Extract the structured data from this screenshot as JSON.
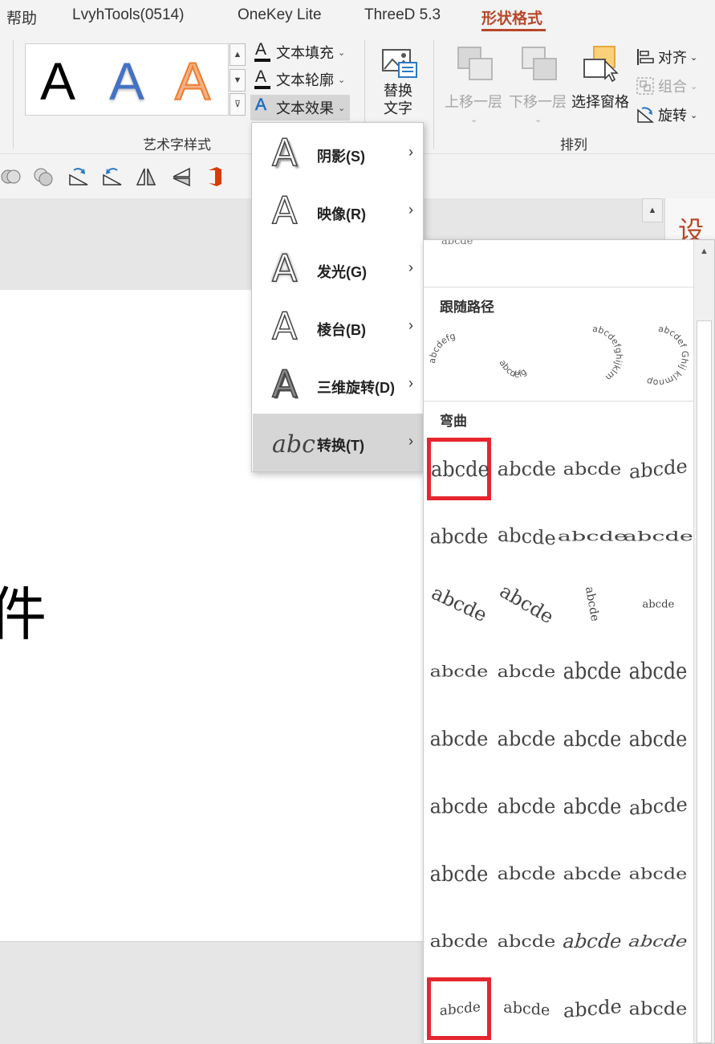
{
  "tabs": [
    "帮助",
    "LvyhTools(0514)",
    "OneKey Lite",
    "ThreeD 5.3",
    "形状格式"
  ],
  "ribbon": {
    "wordart_group_label": "艺术字样式",
    "arrange_group_label": "排列",
    "wordart_samples": [
      "A",
      "A",
      "A"
    ],
    "text_fill": "文本填充",
    "text_outline": "文本轮廓",
    "text_effects": "文本效果",
    "alt_text_line1": "替换",
    "alt_text_line2": "文字",
    "bring_forward": "上移一层",
    "send_backward": "下移一层",
    "selection_pane": "选择窗格",
    "align": "对齐",
    "group": "组合",
    "rotate": "旋转"
  },
  "document": {
    "slide_text": "件",
    "right_pane_title": "设置"
  },
  "text_effects_menu": {
    "items": [
      {
        "label": "阴影(S)",
        "icon": "A"
      },
      {
        "label": "映像(R)",
        "icon": "A"
      },
      {
        "label": "发光(G)",
        "icon": "A"
      },
      {
        "label": "棱台(B)",
        "icon": "A"
      },
      {
        "label": "三维旋转(D)",
        "icon": "A"
      },
      {
        "label": "转换(T)",
        "icon": "abc"
      }
    ]
  },
  "gallery": {
    "top_cut_text": "abcde",
    "section_follow_path": "跟随路径",
    "section_warp": "弯曲",
    "follow_path_samples": [
      "abcdefg",
      "abcdefg",
      "abcdefghijklm",
      "abcdef Ghij klmnop"
    ],
    "warp_tiles": [
      "abcde",
      "abcde",
      "abcde",
      "abcde",
      "abcde",
      "abcde",
      "abcde",
      "abcde",
      "abcde",
      "abcde",
      "abcde",
      "abcde",
      "abcde",
      "abcde",
      "abcde",
      "abcde",
      "abcde",
      "abcde",
      "abcde",
      "abcde",
      "abcde",
      "abcde",
      "abcde",
      "abcde",
      "abcde",
      "abcde",
      "abcde",
      "abcde",
      "abcde",
      "abcde",
      "abcde",
      "abcde",
      "abcde",
      "abcde",
      "abcde",
      "abcde"
    ],
    "selected_tiles": [
      0,
      32
    ]
  },
  "colors": {
    "accent": "#b7472a",
    "selection_box": "#e5262e",
    "menu_hover": "#d6d6d6"
  }
}
